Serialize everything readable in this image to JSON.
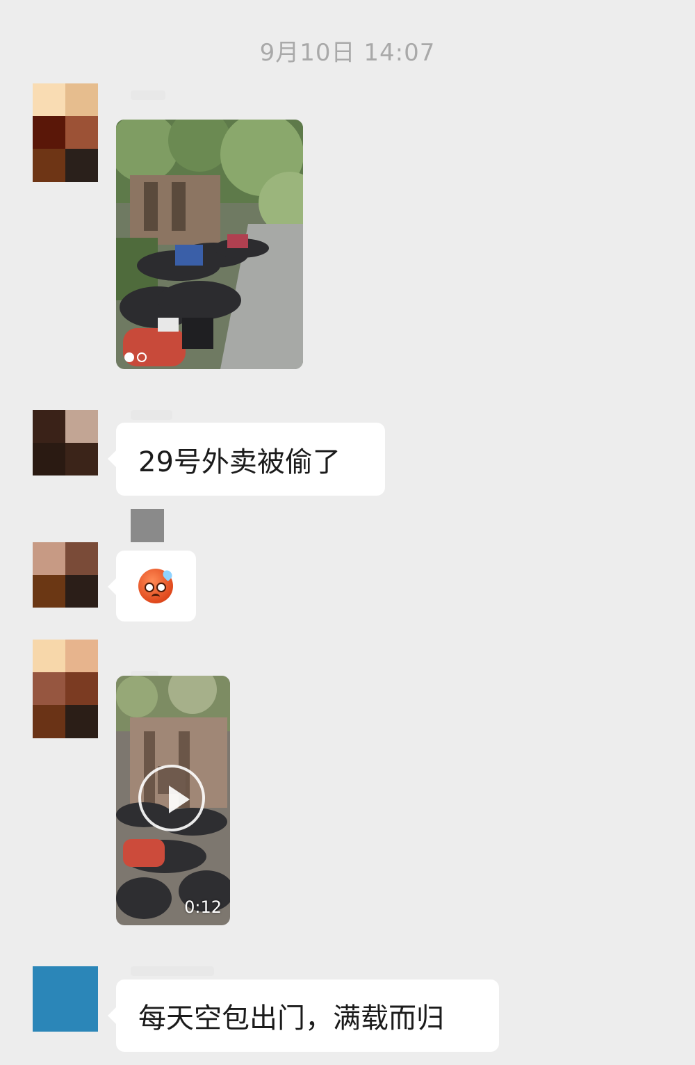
{
  "chat": {
    "timestamp": "9月10日 14:07",
    "messages": [
      {
        "type": "image",
        "content": "电动车停车场照片"
      },
      {
        "type": "text",
        "text": "29号外卖被偷了"
      },
      {
        "type": "emoji",
        "emoji_name": "anxious-sweat-face-icon"
      },
      {
        "type": "video",
        "duration": "0:12"
      },
      {
        "type": "text",
        "text": "每天空包出门，满载而归"
      }
    ]
  },
  "colors": {
    "background": "#ededed",
    "bubble": "#ffffff",
    "text": "#1b1b1b",
    "timestamp": "#a9a9a9"
  }
}
